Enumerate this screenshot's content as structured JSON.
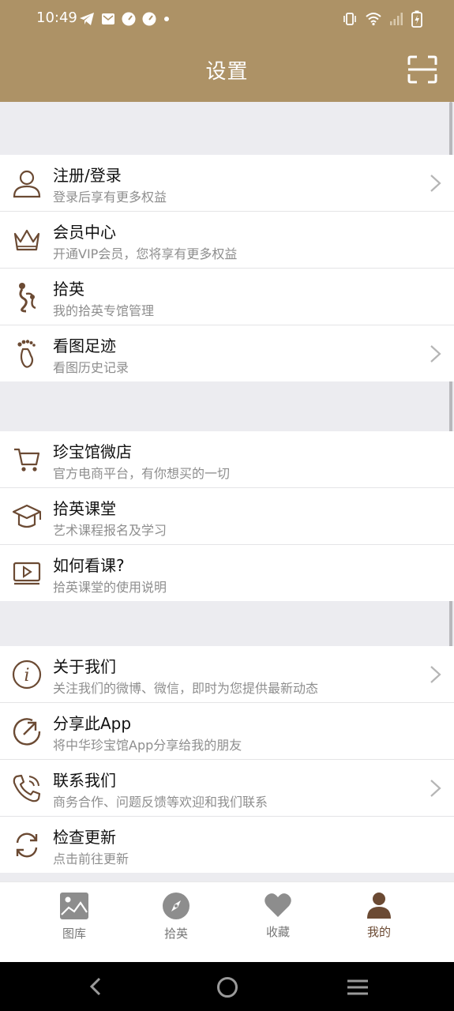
{
  "status_bar": {
    "time": "10:49"
  },
  "header": {
    "title": "设置"
  },
  "groups": [
    {
      "items": [
        {
          "title": "注册/登录",
          "subtitle": "登录后享有更多权益"
        },
        {
          "title": "会员中心",
          "subtitle": "开通VIP会员，您将享有更多权益"
        },
        {
          "title": "拾英",
          "subtitle": "我的拾英专馆管理"
        },
        {
          "title": "看图足迹",
          "subtitle": "看图历史记录"
        }
      ]
    },
    {
      "items": [
        {
          "title": "珍宝馆微店",
          "subtitle": "官方电商平台，有你想买的一切"
        },
        {
          "title": "拾英课堂",
          "subtitle": "艺术课程报名及学习"
        },
        {
          "title": "如何看课?",
          "subtitle": "拾英课堂的使用说明"
        }
      ]
    },
    {
      "items": [
        {
          "title": "关于我们",
          "subtitle": "关注我们的微博、微信，即时为您提供最新动态"
        },
        {
          "title": "分享此App",
          "subtitle": "将中华珍宝馆App分享给我的朋友"
        },
        {
          "title": "联系我们",
          "subtitle": "商务合作、问题反馈等欢迎和我们联系"
        },
        {
          "title": "检查更新",
          "subtitle": "点击前往更新"
        }
      ]
    }
  ],
  "bottom_nav": {
    "tabs": [
      {
        "label": "图库"
      },
      {
        "label": "拾英"
      },
      {
        "label": "收藏"
      },
      {
        "label": "我的"
      }
    ]
  },
  "colors": {
    "brand": "#ad9266",
    "icon": "#6b4a33"
  }
}
